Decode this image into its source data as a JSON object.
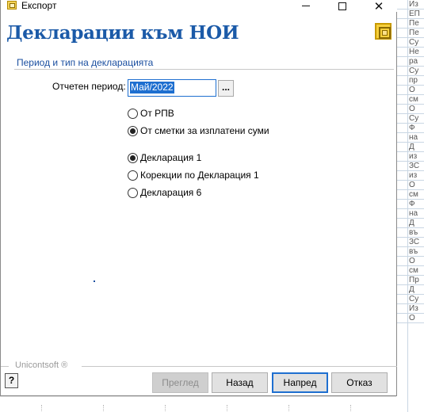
{
  "window": {
    "title": "Експорт",
    "minimize_glyph": "",
    "close_glyph": "✕"
  },
  "header": {
    "title": "Декларации към НОИ"
  },
  "section": {
    "title": "Период и тип на декларацията"
  },
  "period": {
    "label": "Отчетен период:",
    "value": "Май/2022",
    "browse_label": "..."
  },
  "source_options": [
    {
      "label": "От РПВ",
      "checked": false
    },
    {
      "label": "От сметки за изплатени суми",
      "checked": true
    }
  ],
  "declaration_options": [
    {
      "label": "Декларация 1",
      "checked": true
    },
    {
      "label": "Корекции по Декларация 1",
      "checked": false
    },
    {
      "label": "Декларация 6",
      "checked": false
    }
  ],
  "footer": {
    "brand": "Unicontsoft ®",
    "help_glyph": "?",
    "buttons": {
      "preview": "Преглед",
      "back": "Назад",
      "next": "Напред",
      "cancel": "Отказ"
    }
  },
  "background_list": [
    "Из",
    "ЕП",
    "Пе",
    "Пе",
    "Су",
    "Не",
    "ра",
    "Су",
    "пр",
    "О",
    "см",
    "О",
    "Су",
    "Ф",
    "на",
    "Д",
    "из",
    "ЗС",
    "из",
    "О",
    "см",
    "Ф",
    "на",
    "Д",
    "въ",
    "ЗС",
    "въ",
    "О",
    "см",
    "Пр",
    "Д",
    "Су",
    "Из",
    "О"
  ],
  "colors": {
    "header_blue": "#1b5aa8",
    "link_blue": "#1b4fa0",
    "focus_blue": "#1e6fd0",
    "logo_gold": "#f6cf3c"
  }
}
